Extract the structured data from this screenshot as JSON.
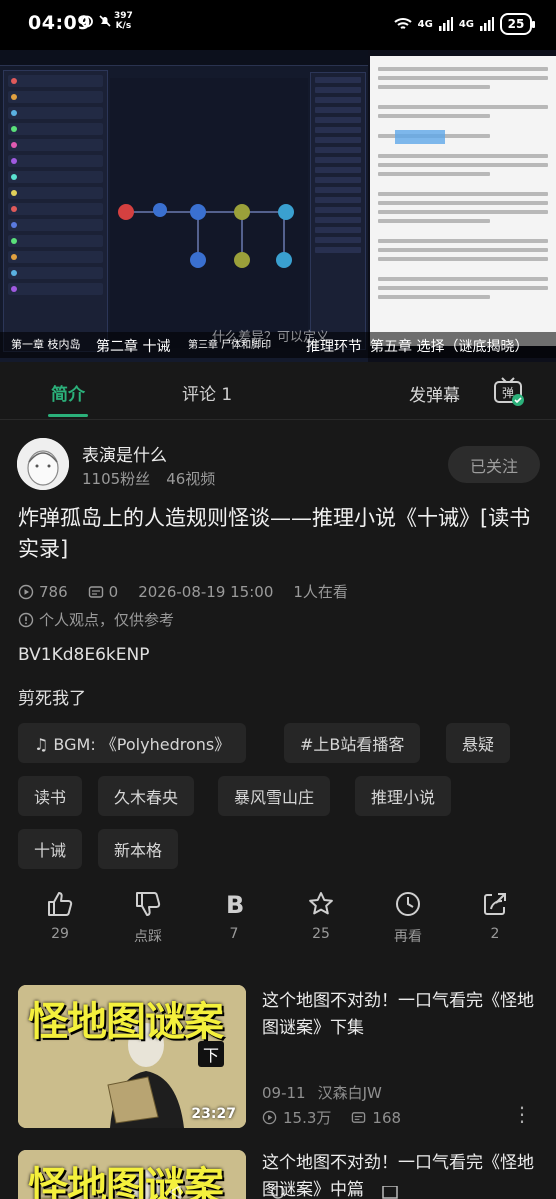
{
  "status_bar": {
    "time": "04:09",
    "speed_value": "397",
    "speed_unit": "K/s",
    "battery": "25",
    "network_1": "4G",
    "network_2": "4G"
  },
  "video": {
    "chapters": [
      "第一章 枝内岛",
      "第二章 十诫",
      "第三章 尸体和脚印",
      "推理环节",
      "第五章 选择（谜底揭晓）"
    ],
    "danmaku": "什么差异？可以定义"
  },
  "tabs": {
    "intro": "简介",
    "comments": "评论 1",
    "send_danmaku": "发弹幕",
    "danmaku_toggle_label": "弹"
  },
  "uploader": {
    "name": "表演是什么",
    "followers": "1105粉丝",
    "videos": "46视频",
    "follow_label": "已关注"
  },
  "video_info": {
    "title": "炸弹孤岛上的人造规则怪谈——推理小说《十诫》[读书实录]",
    "views": "786",
    "danmaku_count": "0",
    "date": "2026-08-19 15:00",
    "watching": "1人在看",
    "notice": "个人观点，仅供参考",
    "bvid": "BV1Kd8E6kENP",
    "description": "剪死我了"
  },
  "tags": [
    "♫ BGM: 《Polyhedrons》",
    "#上B站看播客",
    "悬疑",
    "读书",
    "久木春央",
    "暴风雪山庄",
    "推理小说",
    "十诫",
    "新本格"
  ],
  "actions": {
    "like": "29",
    "dislike": "点踩",
    "coin": "7",
    "favorite": "25",
    "watch_later": "再看",
    "share": "2"
  },
  "related": [
    {
      "thumb_title": "怪地图谜案",
      "thumb_badge": "下",
      "duration": "23:27",
      "title": "这个地图不对劲！一口气看完《怪地图谜案》下集",
      "date": "09-11",
      "author": "汉森白JW",
      "views": "15.3万",
      "danmaku": "168"
    },
    {
      "thumb_title": "怪地图谜案",
      "title": "这个地图不对劲！一口气看完《怪地图谜案》中篇"
    }
  ],
  "colors": {
    "accent": "#2bb07a",
    "background": "#181818",
    "tag_bg": "#262626"
  }
}
